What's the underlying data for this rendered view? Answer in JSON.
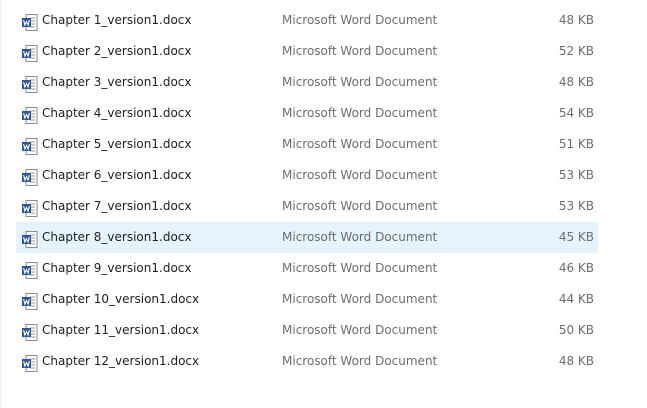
{
  "icon": "word-document-icon",
  "colors": {
    "selection": "#e5f3ff",
    "word_blue": "#2b579a",
    "muted_text": "#6d6d6d"
  },
  "files": [
    {
      "name": "Chapter 1_version1.docx",
      "type": "Microsoft Word Document",
      "size": "48 KB"
    },
    {
      "name": "Chapter 2_version1.docx",
      "type": "Microsoft Word Document",
      "size": "52 KB"
    },
    {
      "name": "Chapter 3_version1.docx",
      "type": "Microsoft Word Document",
      "size": "48 KB"
    },
    {
      "name": "Chapter 4_version1.docx",
      "type": "Microsoft Word Document",
      "size": "54 KB"
    },
    {
      "name": "Chapter 5_version1.docx",
      "type": "Microsoft Word Document",
      "size": "51 KB"
    },
    {
      "name": "Chapter 6_version1.docx",
      "type": "Microsoft Word Document",
      "size": "53 KB"
    },
    {
      "name": "Chapter 7_version1.docx",
      "type": "Microsoft Word Document",
      "size": "53 KB"
    },
    {
      "name": "Chapter 8_version1.docx",
      "type": "Microsoft Word Document",
      "size": "45 KB",
      "selected": true
    },
    {
      "name": "Chapter 9_version1.docx",
      "type": "Microsoft Word Document",
      "size": "46 KB"
    },
    {
      "name": "Chapter 10_version1.docx",
      "type": "Microsoft Word Document",
      "size": "44 KB"
    },
    {
      "name": "Chapter 11_version1.docx",
      "type": "Microsoft Word Document",
      "size": "50 KB"
    },
    {
      "name": "Chapter 12_version1.docx",
      "type": "Microsoft Word Document",
      "size": "48 KB"
    }
  ]
}
